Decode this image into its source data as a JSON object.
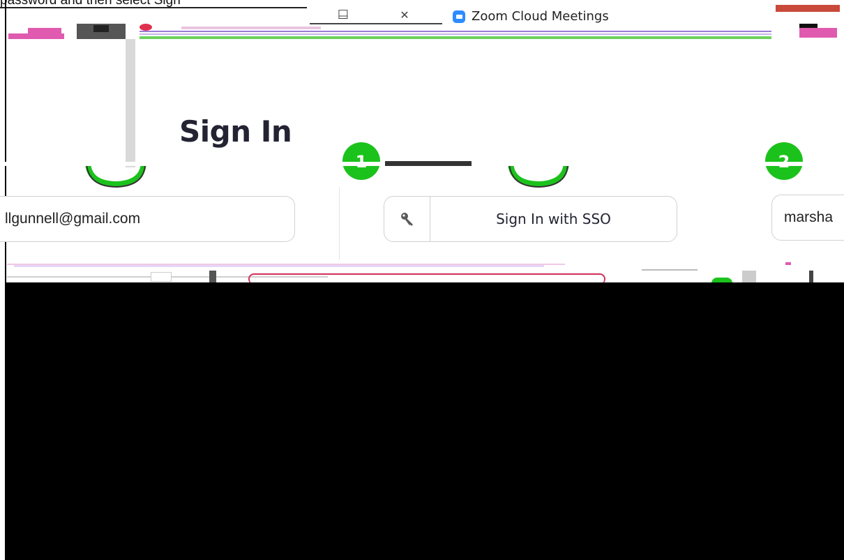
{
  "caption": "password and then select Sign",
  "window": {
    "title": "Zoom Cloud Meetings",
    "minimize_glyph": "—",
    "maximize_glyph": "☐",
    "close_glyph": "✕",
    "icon": "zoom-camera-icon"
  },
  "panel": {
    "title": "Sign In"
  },
  "steps": [
    {
      "label": "1",
      "color": "#1cc21c"
    },
    {
      "label": "2",
      "color": "#1cc21c"
    }
  ],
  "fields": {
    "email_value": "llgunnell@gmail.com",
    "right_field_value": "marsha"
  },
  "sso": {
    "icon": "key-icon",
    "label": "Sign In with SSO"
  },
  "colors": {
    "accent_green": "#1cc21c",
    "zoom_blue": "#2d8cff",
    "close_red": "#c94a3a",
    "text_dark": "#232333"
  }
}
